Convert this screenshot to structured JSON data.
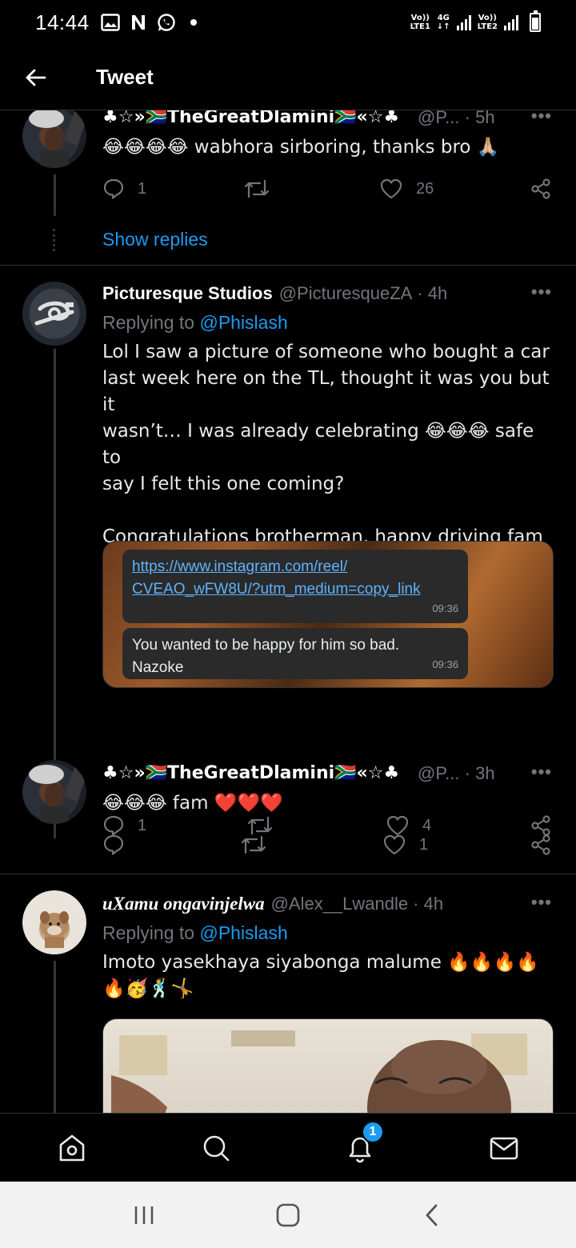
{
  "status_bar": {
    "time": "14:44",
    "left_icons": [
      "gallery-icon",
      "n-icon",
      "whatsapp-icon"
    ],
    "sim1_label": "Vo)) LTE1",
    "sim2_label": "Vo)) LTE2",
    "network": "4G"
  },
  "header": {
    "title": "Tweet"
  },
  "tweets": [
    {
      "name": "♣☆»🇿🇦TheGreatDlamini🇿🇦«☆♣",
      "handle": "@P...",
      "time": "· 5h",
      "text": "😂😂😂😂 wabhora sirboring, thanks bro 🙏🏼",
      "replies": "1",
      "likes": "26",
      "show_replies": "Show replies"
    },
    {
      "name": "Picturesque Studios",
      "handle": "@PicturesqueZA",
      "time": "· 4h",
      "replying_label": "Replying to",
      "replying_to": "@Phislash",
      "text_lines": [
        "Lol I saw a picture of someone who bought a car",
        "last week here on the TL, thought it was you but it",
        "wasn’t… I was already celebrating 😂😂😂 safe to",
        "say I felt this one coming?",
        "",
        "Congratulations brotherman, happy driving fam 🙌🏿",
        "✨"
      ],
      "media": {
        "bubble1_link_line1": "https://www.instagram.com/reel/",
        "bubble1_link_line2": "CVEAO_wFW8U/?utm_medium=copy_link",
        "bubble1_time": "09:36",
        "bubble2_line1": "You wanted to be happy for him so bad.",
        "bubble2_line2": "Nazoke",
        "bubble2_time": "09:36"
      },
      "replies": "1",
      "likes": "4"
    },
    {
      "name": "♣☆»🇿🇦TheGreatDlamini🇿🇦«☆♣",
      "handle": "@P...",
      "time": "· 3h",
      "text": "😂😂😂 fam ❤️❤️❤️",
      "replies": "",
      "likes": "1"
    },
    {
      "name": "uXamu ongavinjelwa",
      "handle": "@Alex__Lwandle",
      "time": "· 4h",
      "replying_label": "Replying to",
      "replying_to": "@Phislash",
      "text_line1": "Imoto yasekhaya siyabonga malume 🔥🔥🔥🔥",
      "text_line2": "🔥🥳🕺🤸"
    }
  ],
  "bottom_nav": {
    "items": [
      "home-icon",
      "search-icon",
      "notifications-icon",
      "messages-icon"
    ],
    "notification_count": "1"
  },
  "colors": {
    "accent": "#1d9bf0",
    "background": "#000000",
    "muted": "#71767b"
  }
}
